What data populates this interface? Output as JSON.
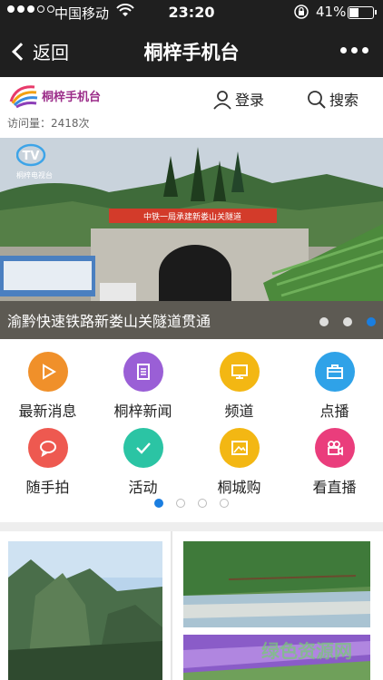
{
  "status": {
    "carrier": "中国移动",
    "time": "23:20",
    "battery": "41%",
    "battery_level": 0.41
  },
  "nav": {
    "back_label": "返回",
    "title": "桐梓手机台"
  },
  "header": {
    "logo_text": "桐梓手机台",
    "visits": "访问量：2418次",
    "login": "登录",
    "search": "搜索"
  },
  "banner": {
    "caption": "渝黔快速铁路新娄山关隧道贯通",
    "sign_text": "中铁一局承建新娄山关隧道",
    "tv_logo_sub": "桐梓电视台",
    "dots_count": 3,
    "active_dot": 2
  },
  "grid": {
    "items": [
      {
        "label": "最新消息",
        "icon": "play-icon",
        "color": "#f0902a"
      },
      {
        "label": "桐梓新闻",
        "icon": "document-icon",
        "color": "#9a5fd6"
      },
      {
        "label": "频道",
        "icon": "monitor-icon",
        "color": "#f3b713"
      },
      {
        "label": "点播",
        "icon": "briefcase-icon",
        "color": "#2fa2e8"
      },
      {
        "label": "随手拍",
        "icon": "chat-icon",
        "color": "#ee5950"
      },
      {
        "label": "活动",
        "icon": "check-icon",
        "color": "#2bc4a4"
      },
      {
        "label": "桐城购",
        "icon": "picture-icon",
        "color": "#f3b713"
      },
      {
        "label": "看直播",
        "icon": "video-camera-icon",
        "color": "#ea3d7c"
      }
    ],
    "pages": 4,
    "active_page": 0
  },
  "watermark": "绿色资源网"
}
